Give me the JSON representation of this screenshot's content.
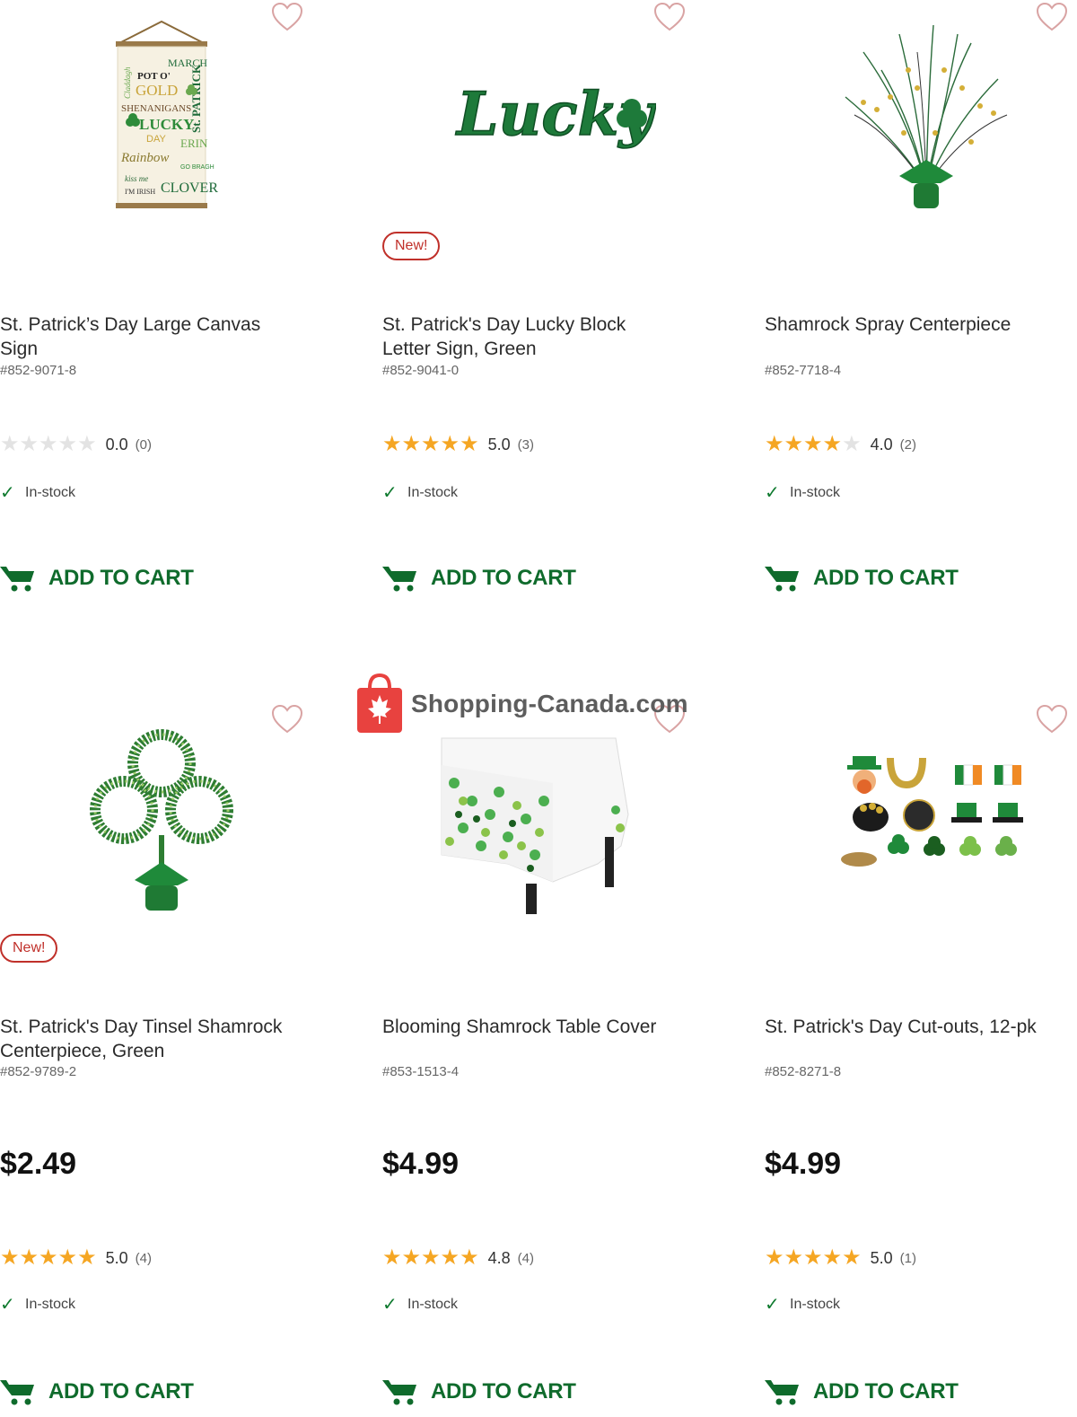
{
  "products": [
    {
      "title": "St. Patrick’s Day Large Canvas Sign",
      "sku": "#852-9071-8",
      "badge": "",
      "price": "",
      "rating": "0.0",
      "count": "(0)",
      "stars": 0,
      "stock": "In-stock",
      "cart": "ADD TO CART",
      "heart_icon": "heart-outline-icon"
    },
    {
      "title": "St. Patrick's Day Lucky Block Letter Sign, Green",
      "sku": "#852-9041-0",
      "badge": "New!",
      "price": "",
      "rating": "5.0",
      "count": "(3)",
      "stars": 5,
      "stock": "In-stock",
      "cart": "ADD TO CART",
      "heart_icon": "heart-outline-icon"
    },
    {
      "title": "Shamrock Spray Centerpiece",
      "sku": "#852-7718-4",
      "badge": "",
      "price": "",
      "rating": "4.0",
      "count": "(2)",
      "stars": 4,
      "stock": "In-stock",
      "cart": "ADD TO CART",
      "heart_icon": "heart-outline-icon"
    },
    {
      "title": "St. Patrick's Day Tinsel Shamrock Centerpiece, Green",
      "sku": "#852-9789-2",
      "badge": "New!",
      "price": "$2.49",
      "rating": "5.0",
      "count": "(4)",
      "stars": 5,
      "stock": "In-stock",
      "cart": "ADD TO CART",
      "heart_icon": "heart-outline-icon"
    },
    {
      "title": "Blooming Shamrock Table Cover",
      "sku": "#853-1513-4",
      "badge": "",
      "price": "$4.99",
      "rating": "4.8",
      "count": "(4)",
      "stars": 5,
      "stock": "In-stock",
      "cart": "ADD TO CART",
      "heart_icon": "heart-outline-icon"
    },
    {
      "title": "St. Patrick's Day Cut-outs, 12-pk",
      "sku": "#852-8271-8",
      "badge": "",
      "price": "$4.99",
      "rating": "5.0",
      "count": "(1)",
      "stars": 5,
      "stock": "In-stock",
      "cart": "ADD TO CART",
      "heart_icon": "heart-outline-icon"
    }
  ],
  "sign_lines": [
    "MARCH",
    "POT O'",
    "GOLD",
    "SHENANIGANS",
    "LUCKY",
    "DAY",
    "ERIN",
    "Rainbow",
    "GO BRAGH",
    "kiss me",
    "I'M IRISH",
    "CLOVER",
    "St. PATRICK",
    "Claddagh"
  ],
  "lucky_text": "Lucky",
  "watermark": "Shopping-Canada.com",
  "colors": {
    "accent_green": "#0f6b2c",
    "star": "#f5a623",
    "badge_red": "#c0302a",
    "watermark_red": "#e8423f"
  }
}
